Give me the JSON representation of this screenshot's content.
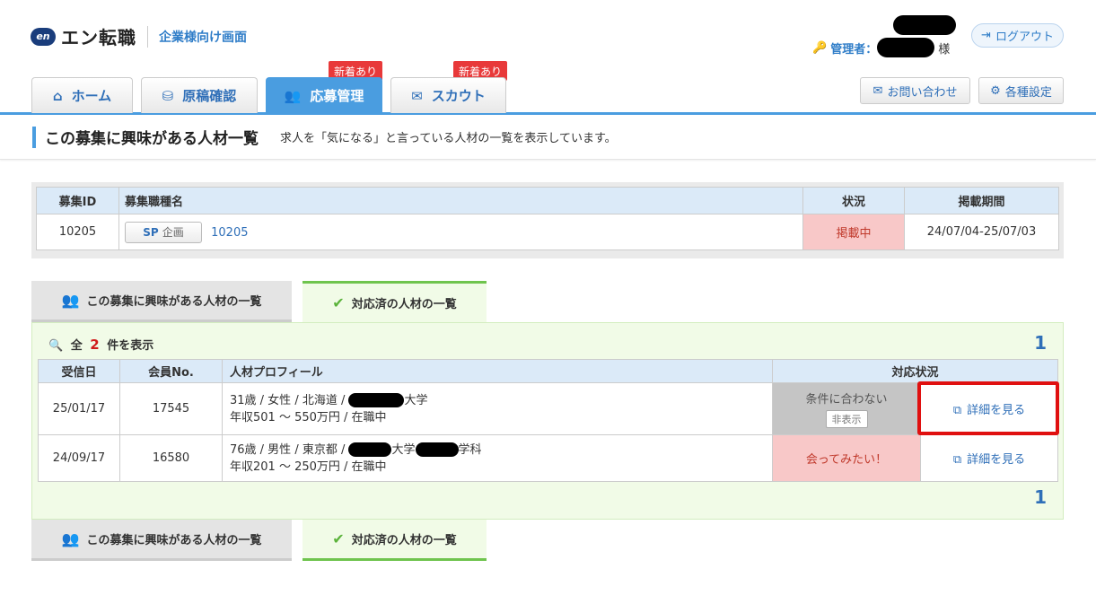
{
  "header": {
    "logo_mark": "en",
    "logo_text": "エン転職",
    "subtitle": "企業様向け画面",
    "admin_label": "管理者：",
    "admin_suffix": "様",
    "logout_label": "ログアウト"
  },
  "nav": {
    "tabs": [
      {
        "label": "ホーム",
        "icon": "home-icon",
        "glyph": "⌂"
      },
      {
        "label": "原稿確認",
        "icon": "document-icon",
        "glyph": "⛁"
      },
      {
        "label": "応募管理",
        "icon": "people-icon",
        "glyph": "👥"
      },
      {
        "label": "スカウト",
        "icon": "mail-icon",
        "glyph": "✉"
      }
    ],
    "badge_new": "新着あり",
    "contact_label": "お問い合わせ",
    "settings_label": "各種設定"
  },
  "page": {
    "title": "この募集に興味がある人材一覧",
    "description": "求人を「気になる」と言っている人材の一覧を表示しています。"
  },
  "job_table": {
    "headers": [
      "募集ID",
      "募集職種名",
      "状況",
      "掲載期間"
    ],
    "row": {
      "id": "10205",
      "plan_label": "SP",
      "plan_type": "企画",
      "job_name": "10205",
      "status": "掲載中",
      "period": "24/07/04-25/07/03"
    }
  },
  "subtabs": {
    "interested": "この募集に興味がある人材の一覧",
    "handled": "対応済の人材の一覧"
  },
  "results": {
    "count_prefix": "全",
    "count": "2",
    "count_suffix": "件を表示",
    "page": "1"
  },
  "candidates": {
    "headers": [
      "受信日",
      "会員No.",
      "人材プロフィール",
      "対応状況"
    ],
    "rows": [
      {
        "date": "25/01/17",
        "member_no": "17545",
        "profile_line1_a": "31歳 / 女性 / 北海道 /",
        "profile_line1_b": "大学",
        "profile_line2": "年収501 ～ 550万円 / 在職中",
        "status": "条件に合わない",
        "status_button": "非表示",
        "detail": "詳細を見る"
      },
      {
        "date": "24/09/17",
        "member_no": "16580",
        "profile_line1_a": "76歳 / 男性 / 東京都 /",
        "profile_line1_b": "大学",
        "profile_line1_c": "学科",
        "profile_line2": "年収201 ～ 250万円 / 在職中",
        "status": "会ってみたい！",
        "detail": "詳細を見る"
      }
    ]
  },
  "colors": {
    "accent": "#4a9de0",
    "link": "#2f6fb8",
    "badge": "#e8393a",
    "green": "#5bb33b",
    "highlight": "#e01010"
  }
}
